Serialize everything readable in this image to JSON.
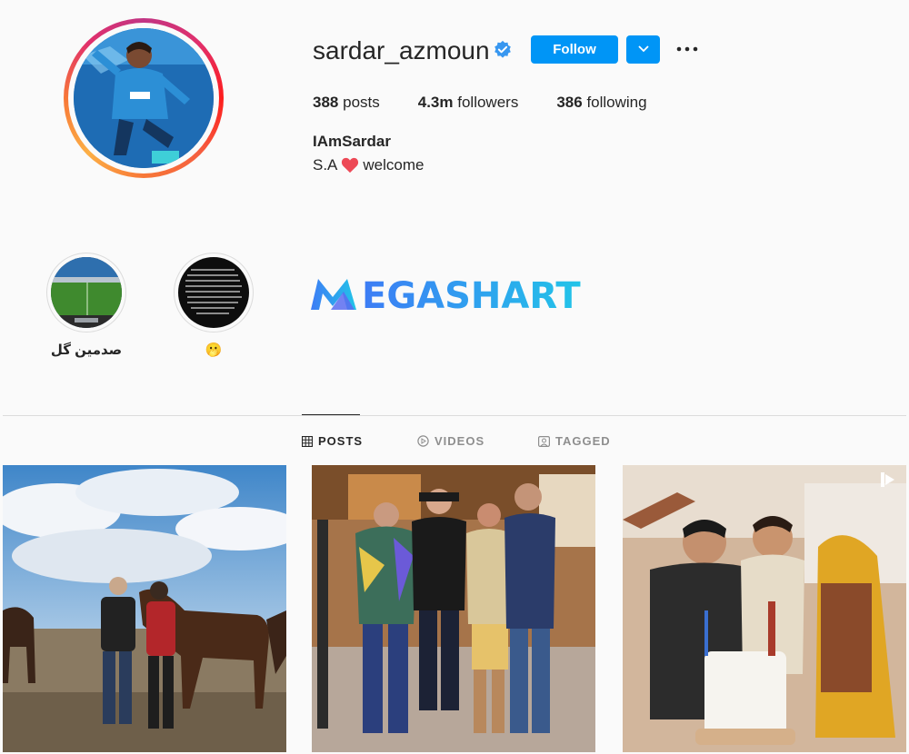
{
  "profile": {
    "username": "sardar_azmoun",
    "follow_label": "Follow",
    "stats": {
      "posts_value": "388",
      "posts_label": "posts",
      "followers_value": "4.3m",
      "followers_label": "followers",
      "following_value": "386",
      "following_label": "following"
    },
    "bio_name": "IAmSardar",
    "bio_prefix": "S.A",
    "bio_suffix": "welcome"
  },
  "highlights": [
    {
      "label": "صدمین گل"
    },
    {
      "label": "🫢"
    }
  ],
  "watermark": {
    "text": "EGASHART"
  },
  "tabs": [
    {
      "label": "POSTS",
      "icon": "grid-icon"
    },
    {
      "label": "VIDEOS",
      "icon": "play-circle-icon"
    },
    {
      "label": "TAGGED",
      "icon": "tag-icon"
    }
  ],
  "colors": {
    "accent": "#0095f6",
    "verified": "#3897f0",
    "heart": "#ed4956",
    "watermark": "#2aa6f0"
  }
}
